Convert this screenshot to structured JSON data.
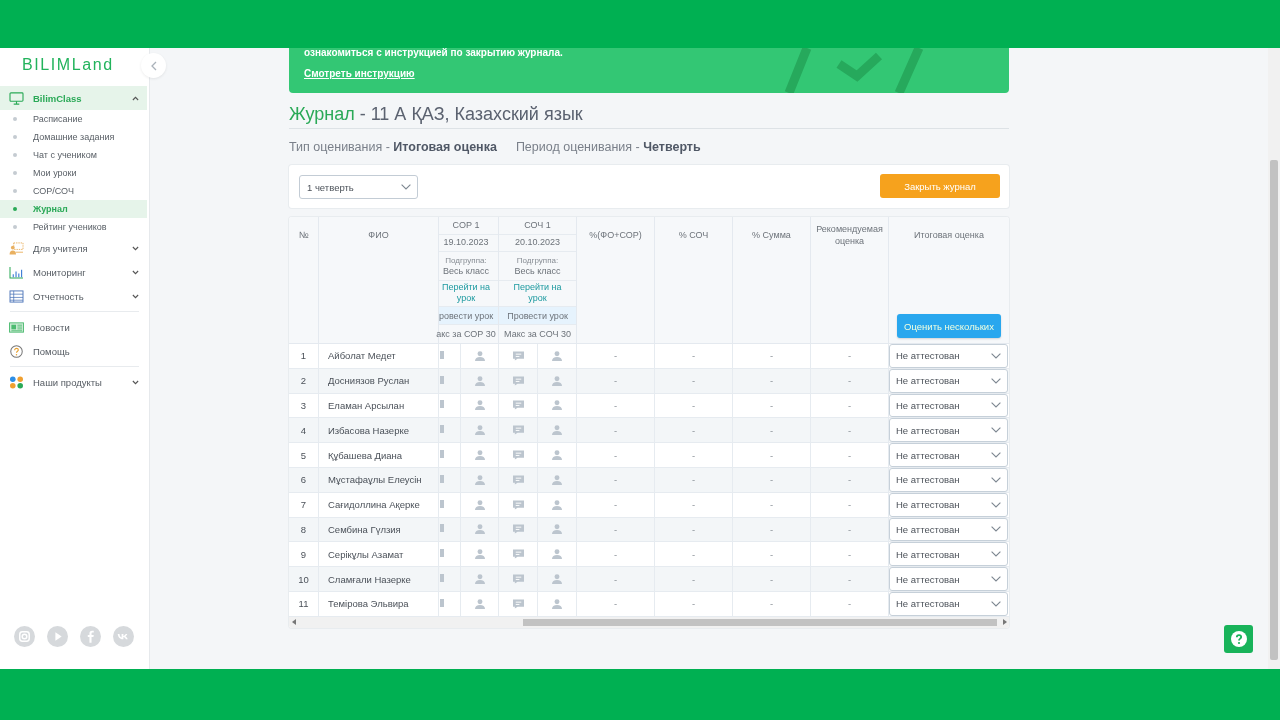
{
  "sidebar": {
    "logo": "BILIMLand",
    "menu": [
      {
        "items": [
          {
            "kind": "group",
            "label": "BilimClass",
            "selected": true,
            "expanded": true,
            "children": [
              {
                "label": "Расписание",
                "selected": false
              },
              {
                "label": "Домашние задания",
                "selected": false
              },
              {
                "label": "Чат с учеником",
                "selected": false
              },
              {
                "label": "Мои уроки",
                "selected": false
              },
              {
                "label": "СОР/СОЧ",
                "selected": false
              },
              {
                "label": "Журнал",
                "selected": true
              },
              {
                "label": "Рейтинг учеников",
                "selected": false
              }
            ]
          },
          {
            "kind": "group",
            "label": "Для учителя",
            "selected": false,
            "expanded": false
          },
          {
            "kind": "group",
            "label": "Мониторинг",
            "selected": false,
            "expanded": false
          },
          {
            "kind": "group",
            "label": "Отчетность",
            "selected": false,
            "expanded": false
          }
        ]
      },
      {
        "items": [
          {
            "kind": "link",
            "label": "Новости",
            "selected": false
          },
          {
            "kind": "link",
            "label": "Помощь",
            "selected": false
          }
        ]
      },
      {
        "items": [
          {
            "kind": "group",
            "label": "Наши продукты",
            "selected": false,
            "expanded": false
          }
        ]
      }
    ]
  },
  "banner": {
    "text": "ознакомиться с инструкцией по закрытию журнала.",
    "link": "Смотреть инструкцию"
  },
  "page_title": {
    "accent": "Журнал",
    "text": "- 11 А ҚАЗ, Казахский язык"
  },
  "grading_type": "Тип оценивания - **Итоговая оценка**",
  "grading_period": "Период оценивания - **Четверть**",
  "toolbar": {
    "period_select": {
      "value": "1 четверть"
    },
    "close_button": "Закрыть журнал"
  },
  "journal_table": {
    "number_column": "№",
    "name_column": "ФИО",
    "lessons": [
      {
        "title": "СОР 1",
        "date": "19.10.2023",
        "subgroup_label": "Подгруппа:",
        "subgroup": "Весь класс",
        "lesson_link": "Перейти на урок",
        "conduct_button": "ровести урок",
        "max_score": "акс за СОР 30"
      },
      {
        "title": "СОЧ 1",
        "date": "20.10.2023",
        "subgroup_label": "Подгруппа:",
        "subgroup": "Весь класс",
        "lesson_link": "Перейти на урок",
        "conduct_button": "Провести урок",
        "max_score": "Макс за СОЧ 30"
      }
    ],
    "summary_columns": [
      "%(ФО+СОР)",
      "% СОЧ",
      "% Сумма",
      "Рекомендуемая оценка"
    ],
    "final_column": {
      "title": "Итоговая оценка",
      "button": "Оценить нескольких"
    },
    "rows": [
      {
        "number": "1",
        "name": "Айболат Медет",
        "values": [
          "-",
          "-",
          "-",
          "-"
        ],
        "grade": "Не аттестован"
      },
      {
        "number": "2",
        "name": "Досниязов Руслан",
        "values": [
          "-",
          "-",
          "-",
          "-"
        ],
        "grade": "Не аттестован"
      },
      {
        "number": "3",
        "name": "Еламан Арсылан",
        "values": [
          "-",
          "-",
          "-",
          "-"
        ],
        "grade": "Не аттестован"
      },
      {
        "number": "4",
        "name": "Избасова Назерке",
        "values": [
          "-",
          "-",
          "-",
          "-"
        ],
        "grade": "Не аттестован"
      },
      {
        "number": "5",
        "name": "Құбашева Диана",
        "values": [
          "-",
          "-",
          "-",
          "-"
        ],
        "grade": "Не аттестован"
      },
      {
        "number": "6",
        "name": "Мұстафаұлы Елеусін",
        "values": [
          "-",
          "-",
          "-",
          "-"
        ],
        "grade": "Не аттестован"
      },
      {
        "number": "7",
        "name": "Сағидоллина Ақерке",
        "values": [
          "-",
          "-",
          "-",
          "-"
        ],
        "grade": "Не аттестован"
      },
      {
        "number": "8",
        "name": "Сембина Гүлзия",
        "values": [
          "-",
          "-",
          "-",
          "-"
        ],
        "grade": "Не аттестован"
      },
      {
        "number": "9",
        "name": "Серікұлы Азамат",
        "values": [
          "-",
          "-",
          "-",
          "-"
        ],
        "grade": "Не аттестован"
      },
      {
        "number": "10",
        "name": "Сламғали Назерке",
        "values": [
          "-",
          "-",
          "-",
          "-"
        ],
        "grade": "Не аттестован"
      },
      {
        "number": "11",
        "name": "Темірова Эльвира",
        "values": [
          "-",
          "-",
          "-",
          "-"
        ],
        "grade": "Не аттестован"
      }
    ]
  }
}
